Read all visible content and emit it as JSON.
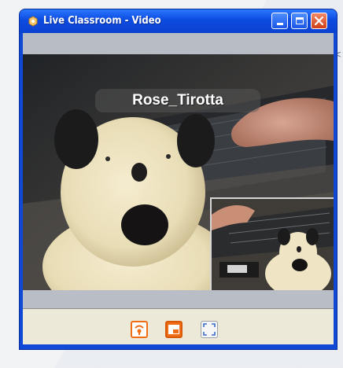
{
  "window": {
    "title": "Live Classroom - Video",
    "title_icon": "app-icon",
    "controls": {
      "minimize_icon": "minimize-icon",
      "maximize_icon": "maximize-icon",
      "close_icon": "close-icon"
    }
  },
  "video": {
    "participant_name": "Rose_Tirotta",
    "main_feed_icon": "webcam-feed",
    "pip_feed_icon": "self-view-feed"
  },
  "toolbar": {
    "buttons": [
      {
        "icon": "broadcast-icon"
      },
      {
        "icon": "picture-in-picture-icon"
      },
      {
        "icon": "fullscreen-icon"
      }
    ]
  },
  "background": {
    "edge_text": "<"
  },
  "colors": {
    "titlebar": "#0c4be0",
    "accent": "#f06d16",
    "close_button": "#cf3f15",
    "toolbar_bg": "#ece9d8"
  }
}
